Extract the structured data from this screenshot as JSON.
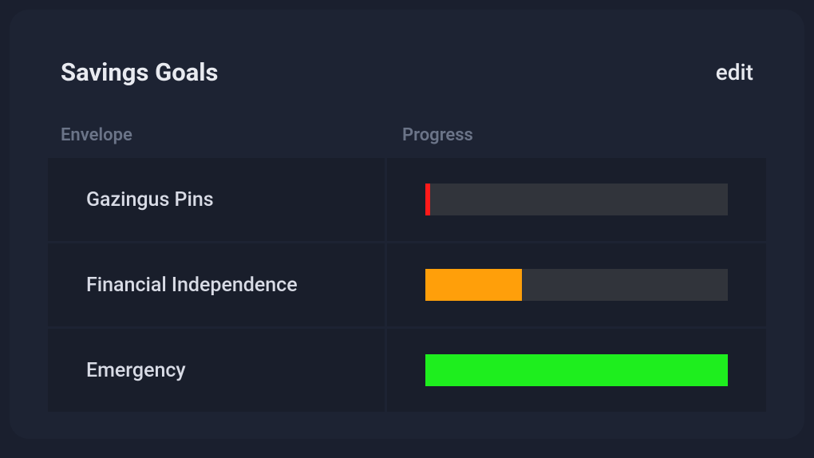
{
  "card": {
    "title": "Savings Goals",
    "edit_label": "edit"
  },
  "headers": {
    "envelope": "Envelope",
    "progress": "Progress"
  },
  "rows": [
    {
      "name": "Gazingus Pins",
      "progress_percent": 1.5,
      "color": "#ff1a1a"
    },
    {
      "name": "Financial Independence",
      "progress_percent": 32,
      "color": "#ff9f0a"
    },
    {
      "name": "Emergency",
      "progress_percent": 100,
      "color": "#1eee1e"
    }
  ]
}
